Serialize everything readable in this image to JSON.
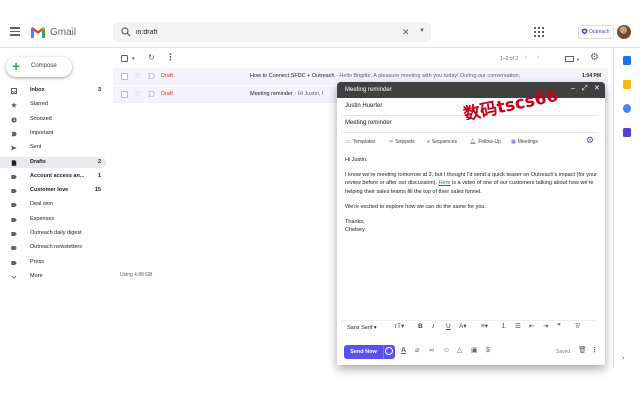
{
  "app": {
    "name": "Gmail",
    "account_badge": "Outreach"
  },
  "search": {
    "value": "in:draft"
  },
  "compose_label": "Compose",
  "nav": [
    {
      "label": "Inbox",
      "count": "3",
      "icon": "inbox-icon",
      "bold": true
    },
    {
      "label": "Starred",
      "count": "",
      "icon": "star-icon"
    },
    {
      "label": "Snoozed",
      "count": "",
      "icon": "clock-icon"
    },
    {
      "label": "Important",
      "count": "",
      "icon": "important-icon"
    },
    {
      "label": "Sent",
      "count": "",
      "icon": "send-icon"
    },
    {
      "label": "Drafts",
      "count": "2",
      "icon": "draft-icon",
      "bold": true,
      "active": true
    },
    {
      "label": "Account access an...",
      "count": "1",
      "icon": "label-icon",
      "bold": true
    },
    {
      "label": "Customer love",
      "count": "15",
      "icon": "label-icon",
      "bold": true
    },
    {
      "label": "Deal won",
      "count": "",
      "icon": "label-icon"
    },
    {
      "label": "Expenses",
      "count": "",
      "icon": "label-icon"
    },
    {
      "label": "Outreach daily digest",
      "count": "",
      "icon": "label-icon"
    },
    {
      "label": "Outreach newsletters",
      "count": "",
      "icon": "label-icon"
    },
    {
      "label": "Press",
      "count": "",
      "icon": "label-icon"
    },
    {
      "label": "More",
      "count": "",
      "icon": "chevron-down-icon"
    }
  ],
  "toolbar": {
    "pager": "1–2 of 2"
  },
  "emails": [
    {
      "tag": "Draft",
      "subject": "How to Connect SFDC + Outreach",
      "snippet": " - Hello Brigitte, A pleasure meeting with you today! During our conversation,",
      "time": "1:04 PM"
    },
    {
      "tag": "Draft",
      "subject": "Meeting reminder",
      "snippet": " - Hi Justin, I",
      "time": ""
    }
  ],
  "storage": "Using 4.88 GB",
  "compose": {
    "title": "Meeting reminder",
    "to": "Justin Huerter",
    "subject": "Meeting reminder",
    "tools": [
      "Templates",
      "Snippets",
      "Sequences",
      "Follow-Up",
      "Meetings"
    ],
    "body": {
      "greeting": "Hi Justin,",
      "p1_before": "I know we're meeting tomorrow at 2, but I thought I'd send a quick teaser on Outreach's impact (for your review before or after our discussion). ",
      "p1_link": "Here",
      "p1_after": " is a video of one of our customers talking about how we're helping their sales teams fill the top of their sales funnel.",
      "p2": "We're excited to explore how we can do the same for you.",
      "signoff": "Thanks,",
      "name": "Chelsey"
    },
    "font": "Sans Serif",
    "send_label": "Send Now",
    "saved": "Saved"
  },
  "watermark": "数码tscs66",
  "colors": {
    "accent": "#5951f3",
    "draft_red": "#d93025",
    "outreach_purple": "#5b3fc9"
  }
}
